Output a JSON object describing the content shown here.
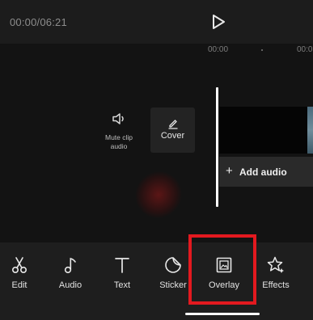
{
  "player": {
    "time": "00:00/06:21",
    "play_icon": "play-icon"
  },
  "timeline": {
    "ruler_start": "00:00",
    "ruler_end": "00:0"
  },
  "clip_tools": {
    "mute_label": "Mute clip audio",
    "cover_label": "Cover"
  },
  "audio_track": {
    "add_audio_label": "Add audio"
  },
  "toolbar": {
    "items": [
      {
        "label": "Edit",
        "icon": "scissors-icon"
      },
      {
        "label": "Audio",
        "icon": "music-note-icon"
      },
      {
        "label": "Text",
        "icon": "text-icon"
      },
      {
        "label": "Sticker",
        "icon": "sticker-icon"
      },
      {
        "label": "Overlay",
        "icon": "overlay-icon"
      },
      {
        "label": "Effects",
        "icon": "effects-icon"
      }
    ],
    "highlighted": "Overlay"
  },
  "colors": {
    "background": "#131313",
    "highlight": "#e3191f",
    "playhead": "#ffffff"
  }
}
